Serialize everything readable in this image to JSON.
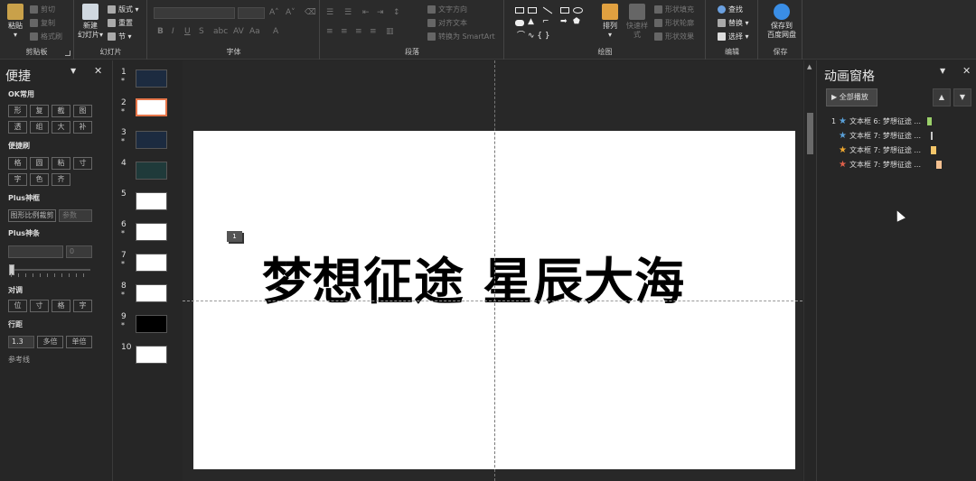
{
  "ribbon": {
    "clipboard": {
      "paste": "粘贴",
      "cut": "剪切",
      "copy": "复制",
      "format_painter": "格式刷",
      "group_label": "剪贴板"
    },
    "slides": {
      "new_slide_line1": "新建",
      "new_slide_line2": "幻灯片",
      "layout": "版式",
      "reset": "重置",
      "section": "节",
      "group_label": "幻灯片"
    },
    "font": {
      "group_label": "字体"
    },
    "paragraph": {
      "text_direction": "文字方向",
      "align_text": "对齐文本",
      "convert_smartart": "转换为 SmartArt",
      "group_label": "段落"
    },
    "drawing": {
      "arrange": "排列",
      "quick_styles": "快速样式",
      "shape_fill": "形状填充",
      "shape_outline": "形状轮廓",
      "shape_effects": "形状效果",
      "group_label": "绘图"
    },
    "editing": {
      "find": "查找",
      "replace": "替换",
      "select": "选择",
      "group_label": "编辑"
    },
    "save": {
      "save_to_line1": "保存到",
      "save_to_line2": "百度网盘",
      "group_label": "保存"
    }
  },
  "left_panel": {
    "title": "便捷",
    "sections": {
      "ok": "OK常用",
      "ok_buttons": [
        "形",
        "复",
        "截",
        "图",
        "透",
        "组",
        "大",
        "补"
      ],
      "quick": "便捷刷",
      "quick_buttons": [
        "格",
        "圆",
        "粘",
        "寸",
        "字",
        "色",
        "齐"
      ],
      "plus_frame": "Plus神框",
      "crop_button": "图形比例裁剪",
      "param_input": "参数",
      "plus_bar": "Plus神条",
      "bar_input_value": "0",
      "align": "对调",
      "align_buttons": [
        "位",
        "寸",
        "格",
        "字"
      ],
      "line_spacing": "行距",
      "spacing_value": "1.3",
      "multiple_button": "多倍",
      "single_button": "单倍",
      "guides": "参考线"
    }
  },
  "thumbnails": {
    "numbers": [
      "1",
      "2",
      "3",
      "4",
      "5",
      "6",
      "7",
      "8",
      "9",
      "10"
    ],
    "star": "*"
  },
  "slide": {
    "headline": "梦想征途  星辰大海",
    "anim_tag": "1"
  },
  "animation_pane": {
    "title": "动画窗格",
    "play_all": "全部播放",
    "items": [
      {
        "num": "1",
        "label": "文本框 6: 梦想征途 ...",
        "star_color": "#5aa0d8",
        "bar_color": "#9bd06a"
      },
      {
        "num": "",
        "label": "文本框 7: 梦想征途 ...",
        "star_color": "#5aa0d8",
        "bar_color": "#c8c8c8"
      },
      {
        "num": "",
        "label": "文本框 7: 梦想征途 ...",
        "star_color": "#f0a830",
        "bar_color": "#f4c66a"
      },
      {
        "num": "",
        "label": "文本框 7: 梦想征途 ...",
        "star_color": "#e0604a",
        "bar_color": "#f4c090"
      }
    ]
  }
}
